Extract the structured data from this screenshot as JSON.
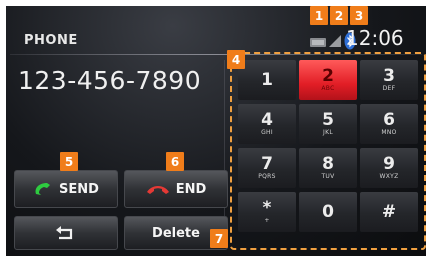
{
  "header": {
    "title": "PHONE",
    "clock": "12:06"
  },
  "status_icons": [
    "signal-bars-icon",
    "signal-strength-icon",
    "bluetooth-icon"
  ],
  "dialer": {
    "number": "123-456-7890"
  },
  "keypad": [
    {
      "digit": "1",
      "letters": ""
    },
    {
      "digit": "2",
      "letters": "ABC"
    },
    {
      "digit": "3",
      "letters": "DEF"
    },
    {
      "digit": "4",
      "letters": "GHI"
    },
    {
      "digit": "5",
      "letters": "JKL"
    },
    {
      "digit": "6",
      "letters": "MNO"
    },
    {
      "digit": "7",
      "letters": "PQRS"
    },
    {
      "digit": "8",
      "letters": "TUV"
    },
    {
      "digit": "9",
      "letters": "WXYZ"
    },
    {
      "digit": "*",
      "letters": "+"
    },
    {
      "digit": "0",
      "letters": ""
    },
    {
      "digit": "#",
      "letters": ""
    }
  ],
  "active_key": "2",
  "buttons": {
    "send": "SEND",
    "end": "END",
    "delete": "Delete"
  },
  "callouts": [
    "1",
    "2",
    "3",
    "4",
    "5",
    "6",
    "7"
  ],
  "colors": {
    "callout": "#f07d1a",
    "send_icon": "#2ecc40",
    "end_icon": "#e53935",
    "active_key": "#e21e26"
  }
}
